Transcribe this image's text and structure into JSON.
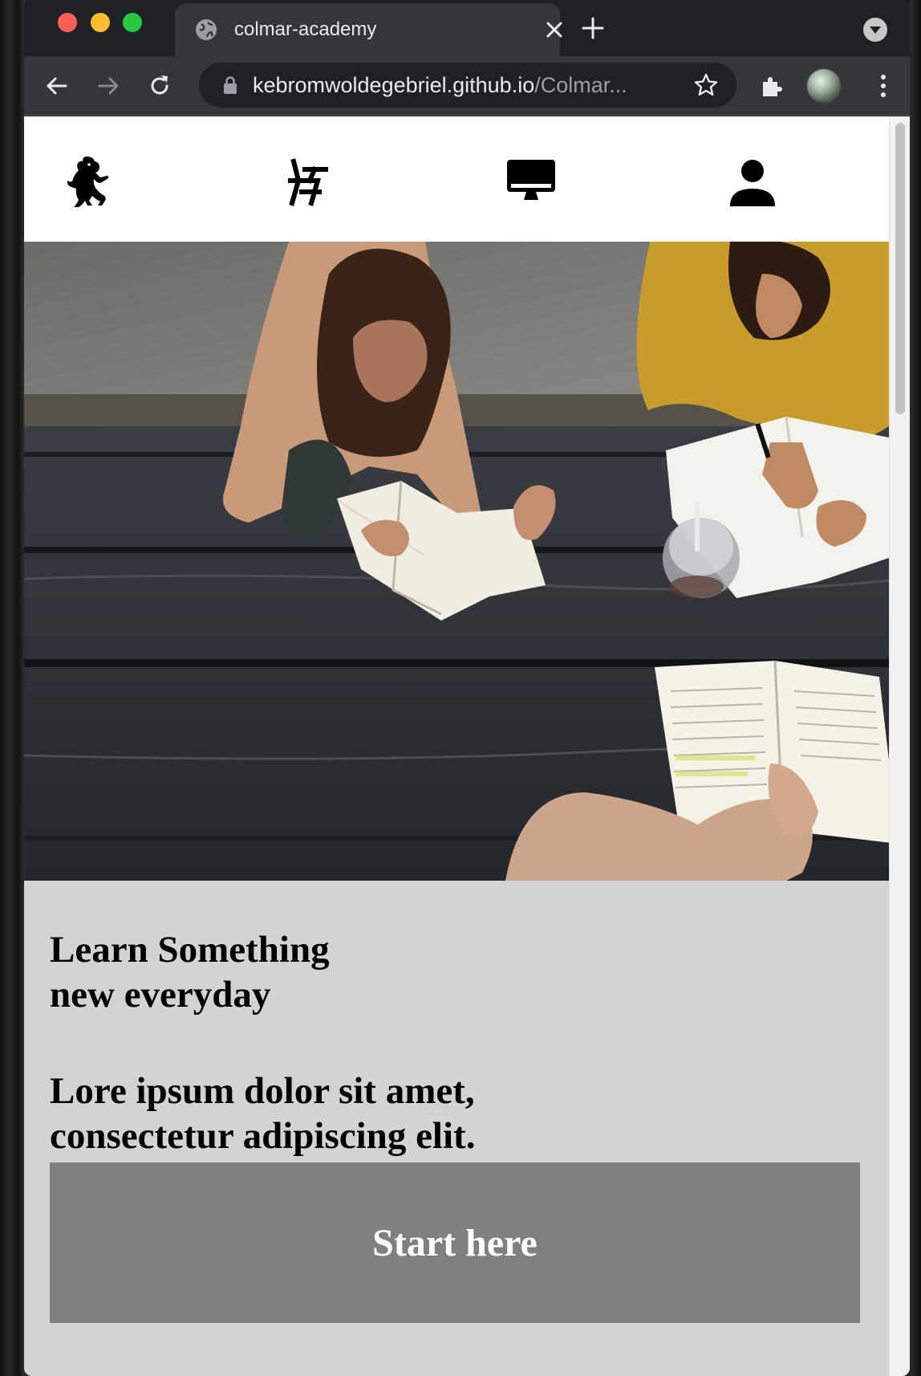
{
  "browser": {
    "tab_title": "colmar-academy",
    "url_host": "kebromwoldegebriel.github.io",
    "url_rest": "/Colmar...",
    "tab_icon": "globe-icon"
  },
  "nav": {
    "items": [
      {
        "icon": "lion-logo-icon"
      },
      {
        "icon": "desk-icon"
      },
      {
        "icon": "monitor-icon"
      },
      {
        "icon": "user-icon"
      }
    ]
  },
  "hero": {
    "image": "students-studying-at-wooden-table"
  },
  "main": {
    "heading_line1": "Learn Something",
    "heading_line2": "new everyday",
    "subheading_line1": "Lore ipsum dolor sit amet,",
    "subheading_line2": "consectetur adipiscing elit.",
    "cta_label": "Start here"
  },
  "colors": {
    "content_bg": "#d3d3d3",
    "cta_bg": "#808080",
    "browser_dark": "#202124",
    "toolbar": "#35363a"
  }
}
